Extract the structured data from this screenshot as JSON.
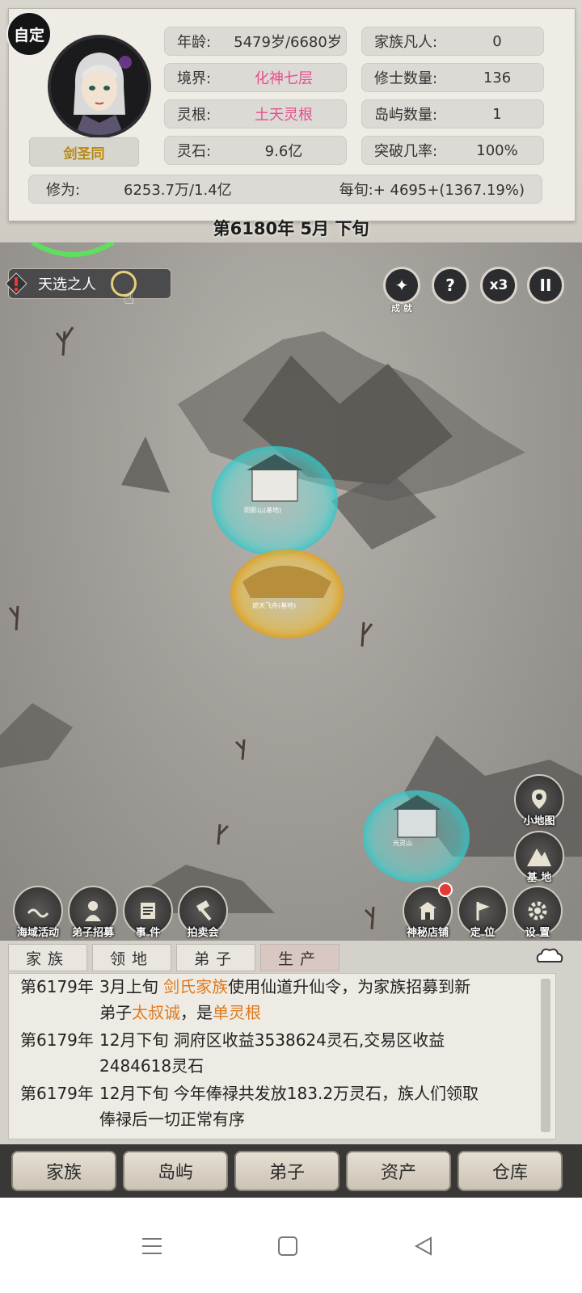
{
  "player": {
    "custom_badge": "自定",
    "name": "剑圣同",
    "age_label": "年龄:",
    "age_value": "5479岁/6680岁",
    "realm_label": "境界:",
    "realm_value": "化神七层",
    "root_label": "灵根:",
    "root_value": "土天灵根",
    "stone_label": "灵石:",
    "stone_value": "9.6亿",
    "cultivation_label": "修为:",
    "cultivation_value": "6253.7万/1.4亿",
    "per_period": "每旬:+ 4695+(1367.19%)"
  },
  "family": {
    "mortals_label": "家族凡人:",
    "mortals_value": "0",
    "cultivators_label": "修士数量:",
    "cultivators_value": "136",
    "islands_label": "岛屿数量:",
    "islands_value": "1",
    "breakthrough_label": "突破几率:",
    "breakthrough_value": "100%"
  },
  "date": "第6180年 5月 下旬",
  "map": {
    "chosen_label": "天选之人",
    "top_buttons": {
      "achievement": "成 就",
      "help": "?",
      "speed": "x3",
      "pause": "II"
    },
    "right_buttons": {
      "minimap": "小地图",
      "base": "基 地"
    },
    "bottom_buttons": [
      {
        "label": "海域活动"
      },
      {
        "label": "弟子招募"
      },
      {
        "label": "事 件"
      },
      {
        "label": "拍卖会"
      },
      {
        "label": "神秘店铺"
      },
      {
        "label": "定 位"
      },
      {
        "label": "设 置"
      }
    ]
  },
  "log": {
    "tabs": [
      "家族",
      "领地",
      "弟子",
      "生产"
    ],
    "active_tab": "生产",
    "entries": [
      {
        "year": "第6179年",
        "line1_pre": "3月上旬 ",
        "line1_hl": "剑氏家族",
        "line1_post": "使用仙道升仙令，为家族招募到新",
        "line2_pre": "弟子",
        "line2_hl1": "太叔诚",
        "line2_mid": "，是",
        "line2_hl2": "单灵根"
      },
      {
        "year": "第6179年",
        "line1": "12月下旬 洞府区收益3538624灵石,交易区收益",
        "line2": "2484618灵石"
      },
      {
        "year": "第6179年",
        "line1": "12月下旬 今年俸禄共发放183.2万灵石，族人们领取",
        "line2": "俸禄后一切正常有序"
      }
    ]
  },
  "nav": [
    "家族",
    "岛屿",
    "弟子",
    "资产",
    "仓库"
  ],
  "colors": {
    "highlight_pink": "#e5508e",
    "highlight_orange": "#e07a1c",
    "name_gold": "#b88a12",
    "shield_cyan": "#4fe3e0",
    "shield_gold": "#f4c542"
  }
}
